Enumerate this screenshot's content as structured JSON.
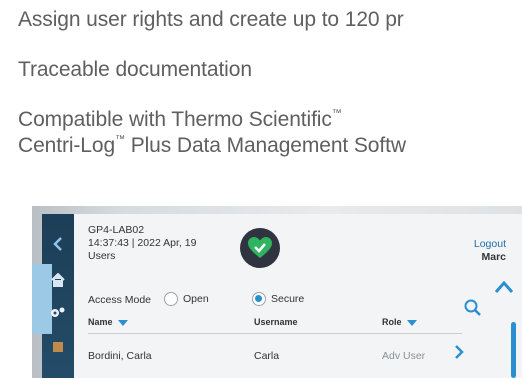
{
  "features": {
    "line1": "Assign user rights and create up to 120 pr",
    "line2": "Traceable documentation",
    "line3_prefix": "Compatible with Thermo Scientific",
    "line4_a": "Centri-Log",
    "line4_b": " Plus Data Management Softw",
    "tm": "™"
  },
  "device": {
    "id": "GP4-LAB02",
    "datetime": "14:37:43 | 2022 Apr, 19",
    "screen_title": "Users",
    "logout_label": "Logout",
    "current_user": "Marc",
    "access_mode_label": "Access Mode",
    "access_options": [
      {
        "label": "Open",
        "selected": false
      },
      {
        "label": "Secure",
        "selected": true
      }
    ],
    "columns": {
      "name": "Name",
      "username": "Username",
      "role": "Role"
    },
    "rows": [
      {
        "name": "Bordini, Carla",
        "username": "Carla",
        "role": "Adv User"
      }
    ],
    "colors": {
      "accent": "#2a8fd1",
      "status_ok": "#2fb35f",
      "sidebar": "#1d3e57"
    }
  }
}
